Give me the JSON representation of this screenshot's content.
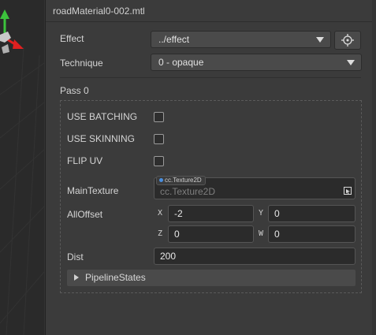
{
  "inspector": {
    "title": "roadMaterial0-002.mtl",
    "effect": {
      "label": "Effect",
      "value": "../effect"
    },
    "technique": {
      "label": "Technique",
      "value": "0 - opaque"
    },
    "pass": {
      "title": "Pass 0",
      "use_batching": {
        "label": "USE BATCHING",
        "checked": false
      },
      "use_skinning": {
        "label": "USE SKINNING",
        "checked": false
      },
      "flip_uv": {
        "label": "FLIP UV",
        "checked": false
      },
      "main_texture": {
        "label": "MainTexture",
        "type_tag": "cc.Texture2D",
        "placeholder": "cc.Texture2D"
      },
      "all_offset": {
        "label": "AllOffset",
        "x_label": "X",
        "x": "-2",
        "y_label": "Y",
        "y": "0",
        "z_label": "Z",
        "z": "0",
        "w_label": "W",
        "w": "0"
      },
      "dist": {
        "label": "Dist",
        "value": "200"
      },
      "pipeline_states": {
        "label": "PipelineStates",
        "expanded": false
      }
    }
  },
  "colors": {
    "panel_bg": "#3b3b3b",
    "input_bg": "#2b2b2b",
    "gizmo_y": "#3cc23c",
    "gizmo_x": "#e02020",
    "asset_dot": "#4a8fe0"
  }
}
